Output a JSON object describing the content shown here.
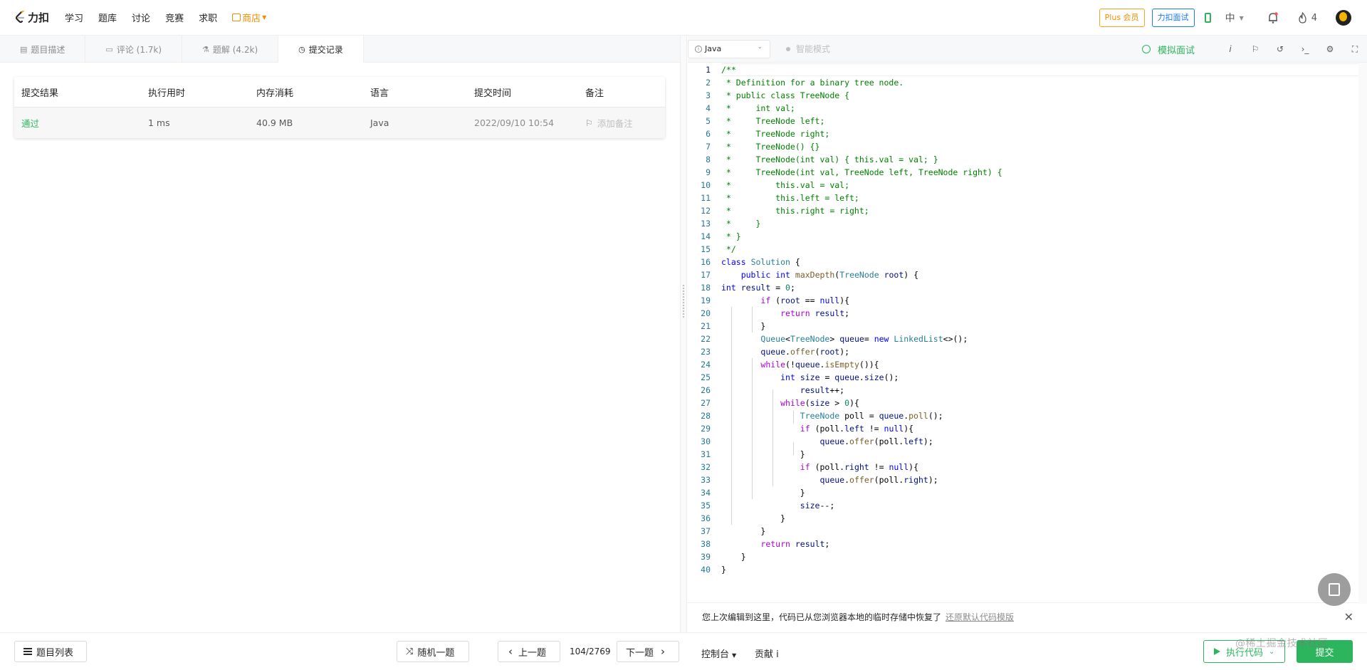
{
  "nav": {
    "logo_text": "力扣",
    "links": [
      "学习",
      "题库",
      "讨论",
      "竞赛",
      "求职"
    ],
    "shop": "商店",
    "plus": "Plus 会员",
    "interview": "力扣面试",
    "lang": "中",
    "fire_count": "4"
  },
  "left": {
    "tabs": [
      {
        "label": "题目描述",
        "icon": "description-icon"
      },
      {
        "label": "评论 (1.7k)",
        "icon": "comment-icon"
      },
      {
        "label": "题解 (4.2k)",
        "icon": "flask-icon"
      },
      {
        "label": "提交记录",
        "icon": "clock-icon"
      }
    ],
    "table": {
      "headers": [
        "提交结果",
        "执行用时",
        "内存消耗",
        "语言",
        "提交时间",
        "备注"
      ],
      "rows": [
        {
          "result": "通过",
          "time": "1 ms",
          "memory": "40.9 MB",
          "language": "Java",
          "submitted": "2022/09/10 10:54",
          "note": "添加备注"
        }
      ]
    }
  },
  "editor": {
    "language": "Java",
    "smart_mode": "智能模式",
    "mock_interview": "模拟面试",
    "tool_icons": [
      "info-icon",
      "flag-icon",
      "reset-icon",
      "terminal-icon",
      "settings-icon",
      "fullscreen-icon"
    ],
    "code_lines": [
      "/**",
      " * Definition for a binary tree node.",
      " * public class TreeNode {",
      " *     int val;",
      " *     TreeNode left;",
      " *     TreeNode right;",
      " *     TreeNode() {}",
      " *     TreeNode(int val) { this.val = val; }",
      " *     TreeNode(int val, TreeNode left, TreeNode right) {",
      " *         this.val = val;",
      " *         this.left = left;",
      " *         this.right = right;",
      " *     }",
      " * }",
      " */",
      "class Solution {",
      "    public int maxDepth(TreeNode root) {",
      "int result = 0;",
      "        if (root == null){",
      "            return result;",
      "        }",
      "        Queue<TreeNode> queue= new LinkedList<>();",
      "        queue.offer(root);",
      "        while(!queue.isEmpty()){",
      "            int size = queue.size();",
      "                result++;",
      "            while(size > 0){",
      "                TreeNode poll = queue.poll();",
      "                if (poll.left != null){",
      "                    queue.offer(poll.left);",
      "                }",
      "                if (poll.right != null){",
      "                    queue.offer(poll.right);",
      "                }",
      "                size--;",
      "            }",
      "        }",
      "        return result;",
      "    }",
      "}"
    ],
    "restore_msg": "您上次编辑到这里，代码已从您浏览器本地的临时存储中恢复了",
    "restore_link": "还原默认代码模版"
  },
  "bottom": {
    "question_list": "题目列表",
    "random": "随机一题",
    "prev": "上一题",
    "counter": "104/2769",
    "next": "下一题",
    "console": "控制台",
    "contribute": "贡献 i",
    "run": "执行代码",
    "submit": "提交",
    "watermark": "@稀土掘金技术社区"
  }
}
